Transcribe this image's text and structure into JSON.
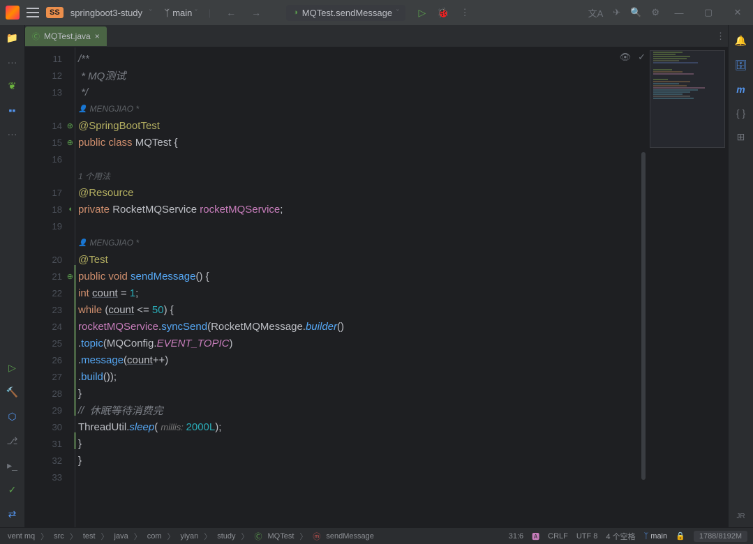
{
  "titlebar": {
    "project": "springboot3-study",
    "project_badge": "SS",
    "branch": "main",
    "run_config": "MQTest.sendMessage"
  },
  "tab": {
    "name": "MQTest.java"
  },
  "gutter_lines": [
    "11",
    "12",
    "13",
    "",
    "14",
    "15",
    "16",
    "",
    "17",
    "18",
    "19",
    "",
    "20",
    "21",
    "22",
    "23",
    "24",
    "25",
    "26",
    "27",
    "28",
    "29",
    "30",
    "31",
    "32",
    "33"
  ],
  "code": {
    "c1": "/**",
    "c2": " * MQ测试",
    "c3": " */",
    "author1": "MENGJIAO *",
    "l14": "@SpringBootTest",
    "l15_public": "public ",
    "l15_class": "class ",
    "l15_name": "MQTest ",
    "l15_brace": "{",
    "usage_hint": "1 个用法",
    "l17": "@Resource",
    "l18_private": "private ",
    "l18_type": "RocketMQService ",
    "l18_field": "rocketMQService",
    "l18_semi": ";",
    "author2": "MENGJIAO *",
    "l20": "@Test",
    "l21_public": "public ",
    "l21_void": "void ",
    "l21_method": "sendMessage",
    "l21_paren": "() {",
    "l22_int": "int ",
    "l22_count": "count",
    "l22_eq": " = ",
    "l22_val": "1",
    "l22_semi": ";",
    "l23_while": "while ",
    "l23_open": "(",
    "l23_count": "count",
    "l23_op": " <= ",
    "l23_num": "50",
    "l23_close": ") {",
    "l24_svc": "rocketMQService",
    "l24_dot": ".",
    "l24_send": "syncSend",
    "l24_open": "(",
    "l24_msg": "RocketMQMessage",
    "l24_dot2": ".",
    "l24_builder": "builder",
    "l24_paren": "()",
    "l25_dot": ".",
    "l25_topic": "topic",
    "l25_open": "(",
    "l25_cfg": "MQConfig",
    "l25_dot2": ".",
    "l25_field": "EVENT_TOPIC",
    "l25_close": ")",
    "l26_dot": ".",
    "l26_msg": "message",
    "l26_open": "(",
    "l26_count": "count",
    "l26_inc": "++)",
    "l27_dot": ".",
    "l27_build": "build",
    "l27_close": "());",
    "l28": "}",
    "l29_slash": "// ",
    "l29_txt": " 休眠等待消费完",
    "l30_util": "ThreadUtil",
    "l30_dot": ".",
    "l30_sleep": "sleep",
    "l30_open": "( ",
    "l30_hint": "millis: ",
    "l30_val": "2000L",
    "l30_close": ");",
    "l31": "}",
    "l32": "}"
  },
  "breadcrumb": [
    "vent mq",
    "src",
    "test",
    "java",
    "com",
    "yiyan",
    "study",
    "MQTest",
    "sendMessage"
  ],
  "status": {
    "pos": "31:6",
    "line_sep": "CRLF",
    "encoding": "UTF 8",
    "indent": "4 个空格",
    "branch": "main",
    "mem": "1788/8192M"
  }
}
